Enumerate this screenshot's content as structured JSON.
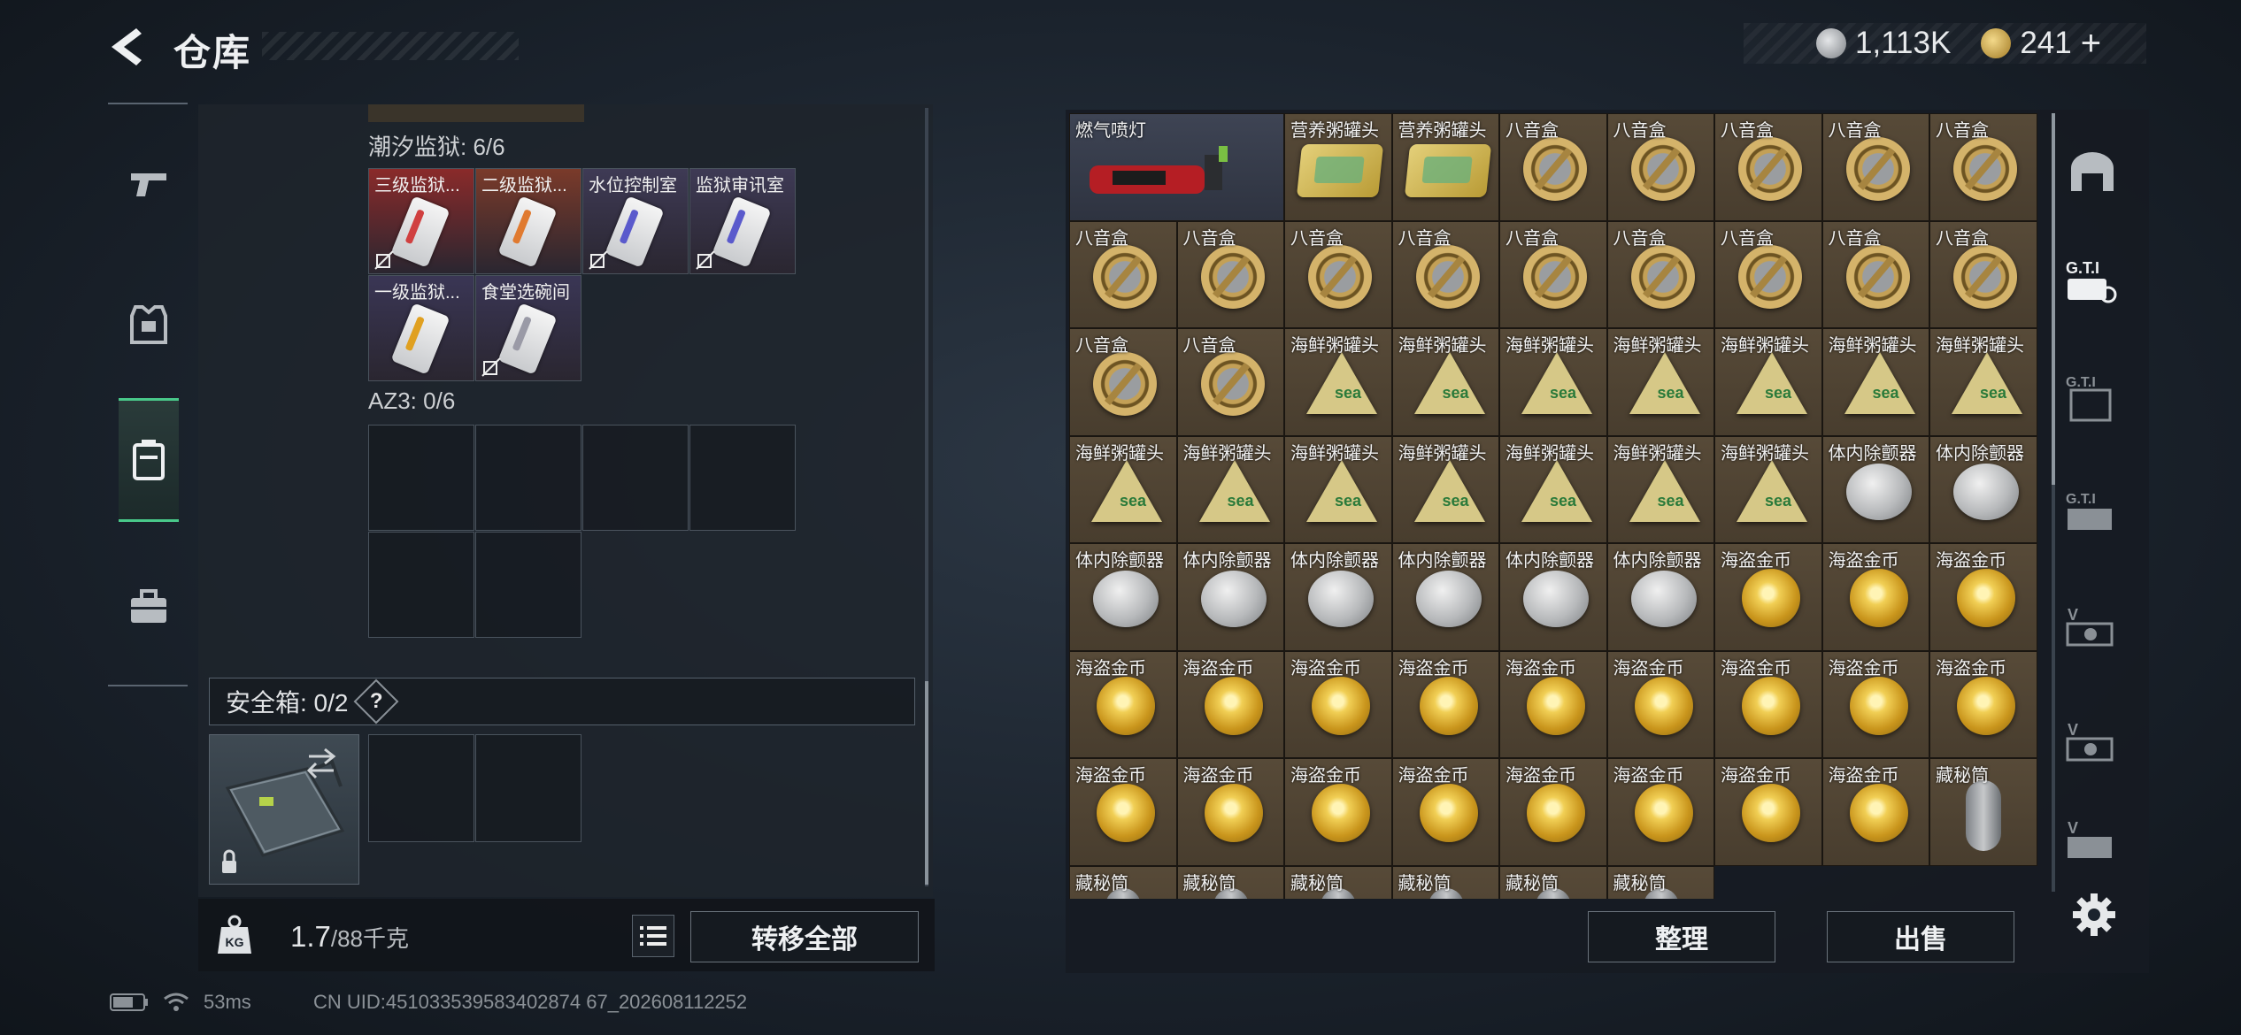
{
  "header": {
    "title": "仓库",
    "money": "1,113K",
    "gold": "241",
    "gold_plus": "+"
  },
  "left_nav": {
    "items": [
      "weapon-icon",
      "armor-icon",
      "container-icon",
      "briefcase-icon"
    ],
    "active_index": 2
  },
  "keychain": {
    "section1": {
      "label": "潮汐监狱: 6/6",
      "keys": [
        {
          "name": "三级监狱...",
          "color": "#8a2a2a",
          "key_color": "#d04040",
          "bound": true
        },
        {
          "name": "二级监狱...",
          "color": "#7a3a2a",
          "key_color": "#e07a30",
          "bound": false
        },
        {
          "name": "水位控制室",
          "color": "#3e3a55",
          "key_color": "#5a5acc",
          "bound": true
        },
        {
          "name": "监狱审讯室",
          "color": "#3e3a55",
          "key_color": "#5a5acc",
          "bound": true
        },
        {
          "name": "一级监狱...",
          "color": "#3a3655",
          "key_color": "#e0a020",
          "bound": false
        },
        {
          "name": "食堂选碗间",
          "color": "#3a3655",
          "key_color": "#9a9aa6",
          "bound": true
        }
      ]
    },
    "section2": {
      "label": "AZ3: 0/6"
    }
  },
  "safebox": {
    "label": "安全箱: 0/2",
    "help": "?"
  },
  "footer_left": {
    "weight_current": "1.7",
    "weight_max": "/88千克",
    "transfer_label": "转移全部"
  },
  "items": [
    {
      "name": "燃气喷灯",
      "type": "torch"
    },
    {
      "name": "营养粥罐头",
      "type": "tin"
    },
    {
      "name": "营养粥罐头",
      "type": "tin"
    },
    {
      "name": "八音盒",
      "type": "dish"
    },
    {
      "name": "八音盒",
      "type": "dish"
    },
    {
      "name": "八音盒",
      "type": "dish"
    },
    {
      "name": "八音盒",
      "type": "dish"
    },
    {
      "name": "八音盒",
      "type": "dish"
    },
    {
      "name": "八音盒",
      "type": "dish"
    },
    {
      "name": "八音盒",
      "type": "dish"
    },
    {
      "name": "八音盒",
      "type": "dish"
    },
    {
      "name": "八音盒",
      "type": "dish"
    },
    {
      "name": "八音盒",
      "type": "dish"
    },
    {
      "name": "八音盒",
      "type": "dish"
    },
    {
      "name": "八音盒",
      "type": "dish"
    },
    {
      "name": "八音盒",
      "type": "dish"
    },
    {
      "name": "八音盒",
      "type": "dish"
    },
    {
      "name": "八音盒",
      "type": "dish"
    },
    {
      "name": "八音盒",
      "type": "dish"
    },
    {
      "name": "海鲜粥罐头",
      "type": "tri"
    },
    {
      "name": "海鲜粥罐头",
      "type": "tri"
    },
    {
      "name": "海鲜粥罐头",
      "type": "tri"
    },
    {
      "name": "海鲜粥罐头",
      "type": "tri"
    },
    {
      "name": "海鲜粥罐头",
      "type": "tri"
    },
    {
      "name": "海鲜粥罐头",
      "type": "tri"
    },
    {
      "name": "海鲜粥罐头",
      "type": "tri"
    },
    {
      "name": "海鲜粥罐头",
      "type": "tri"
    },
    {
      "name": "海鲜粥罐头",
      "type": "tri"
    },
    {
      "name": "海鲜粥罐头",
      "type": "tri"
    },
    {
      "name": "海鲜粥罐头",
      "type": "tri"
    },
    {
      "name": "海鲜粥罐头",
      "type": "tri"
    },
    {
      "name": "海鲜粥罐头",
      "type": "tri"
    },
    {
      "name": "海鲜粥罐头",
      "type": "tri"
    },
    {
      "name": "体内除颤器",
      "type": "tag"
    },
    {
      "name": "体内除颤器",
      "type": "tag"
    },
    {
      "name": "体内除颤器",
      "type": "tag"
    },
    {
      "name": "体内除颤器",
      "type": "tag"
    },
    {
      "name": "体内除颤器",
      "type": "tag"
    },
    {
      "name": "体内除颤器",
      "type": "tag"
    },
    {
      "name": "体内除颤器",
      "type": "tag"
    },
    {
      "name": "体内除颤器",
      "type": "tag"
    },
    {
      "name": "海盗金币",
      "type": "coin"
    },
    {
      "name": "海盗金币",
      "type": "coin"
    },
    {
      "name": "海盗金币",
      "type": "coin"
    },
    {
      "name": "海盗金币",
      "type": "coin"
    },
    {
      "name": "海盗金币",
      "type": "coin"
    },
    {
      "name": "海盗金币",
      "type": "coin"
    },
    {
      "name": "海盗金币",
      "type": "coin"
    },
    {
      "name": "海盗金币",
      "type": "coin"
    },
    {
      "name": "海盗金币",
      "type": "coin"
    },
    {
      "name": "海盗金币",
      "type": "coin"
    },
    {
      "name": "海盗金币",
      "type": "coin"
    },
    {
      "name": "海盗金币",
      "type": "coin"
    },
    {
      "name": "海盗金币",
      "type": "coin"
    },
    {
      "name": "海盗金币",
      "type": "coin"
    },
    {
      "name": "海盗金币",
      "type": "coin"
    },
    {
      "name": "海盗金币",
      "type": "coin"
    },
    {
      "name": "海盗金币",
      "type": "coin"
    },
    {
      "name": "海盗金币",
      "type": "coin"
    },
    {
      "name": "海盗金币",
      "type": "coin"
    },
    {
      "name": "海盗金币",
      "type": "coin"
    },
    {
      "name": "藏秘筒",
      "type": "tube"
    },
    {
      "name": "藏秘筒",
      "type": "tube"
    },
    {
      "name": "藏秘筒",
      "type": "tube"
    },
    {
      "name": "藏秘筒",
      "type": "tube"
    },
    {
      "name": "藏秘筒",
      "type": "tube"
    },
    {
      "name": "藏秘筒",
      "type": "tube"
    },
    {
      "name": "藏秘筒",
      "type": "tube"
    }
  ],
  "footer_right": {
    "tidy_label": "整理",
    "sell_label": "出售"
  },
  "right_nav": {
    "items": [
      "gate-icon",
      "gti-id-icon",
      "gti-box-icon",
      "gti-card-icon",
      "v-card-icon-1",
      "v-card-icon-2",
      "v-card-icon-3"
    ]
  },
  "status": {
    "ping": "53ms",
    "uid": "CN UID:451033539583402874 67_202608112252"
  },
  "colors": {
    "accent_green": "#49c98a",
    "item_bg": "#4f4333",
    "key_red": "#8a2a2a",
    "key_purple": "#3e3a55"
  }
}
